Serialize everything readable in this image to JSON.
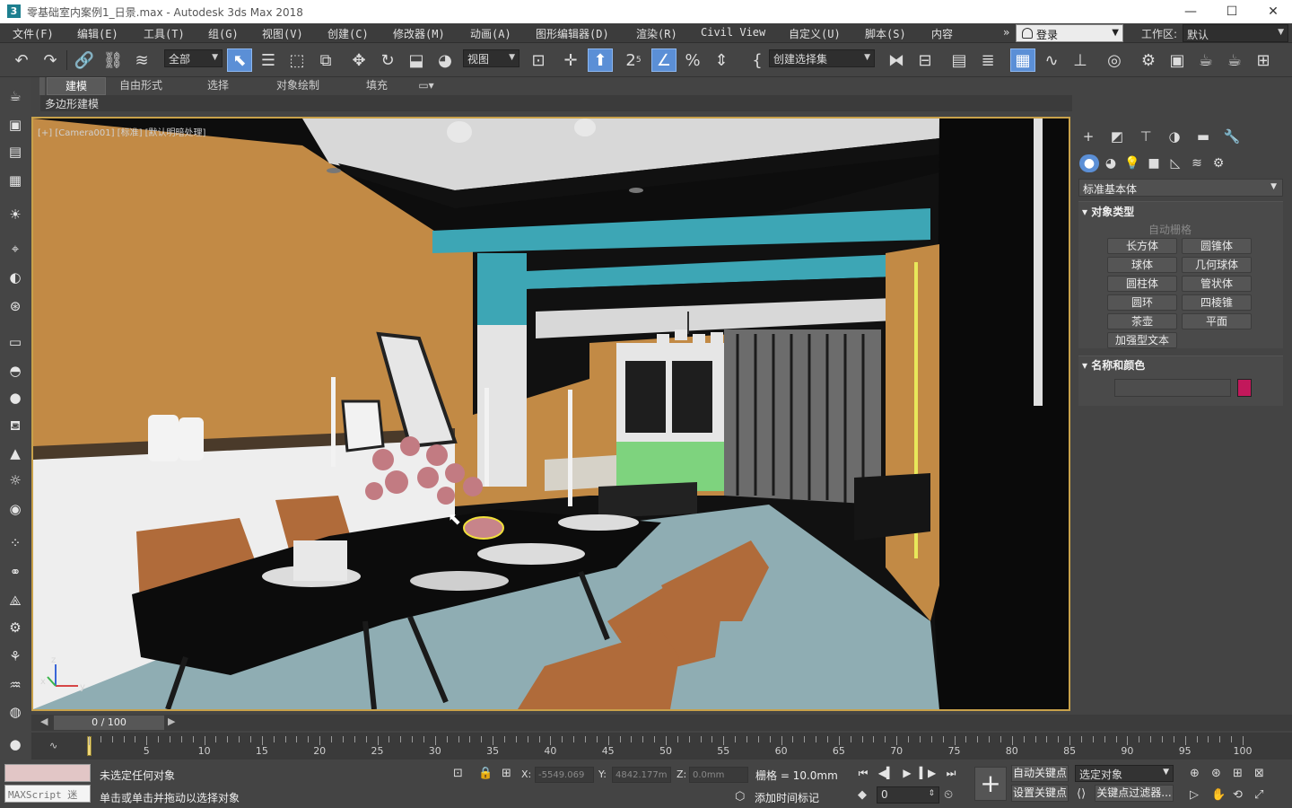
{
  "window": {
    "title": "零基础室内案例1_日景.max - Autodesk 3ds Max 2018",
    "app_icon": "3",
    "minimize": "—",
    "maximize": "☐",
    "close": "✕"
  },
  "menu": {
    "items": [
      "文件(F)",
      "编辑(E)",
      "工具(T)",
      "组(G)",
      "视图(V)",
      "创建(C)",
      "修改器(M)",
      "动画(A)",
      "图形编辑器(D)",
      "渲染(R)",
      "Civil View",
      "自定义(U)",
      "脚本(S)",
      "内容"
    ],
    "overflow": "»",
    "login": "登录",
    "workspace_label": "工作区:",
    "workspace_value": "默认"
  },
  "toolbar": {
    "selection_filter": "全部",
    "reference_coord": "视图",
    "named_selection": "创建选择集",
    "snap_angle_label": "2",
    "snap_sub": "5"
  },
  "ribbon": {
    "tabs": [
      "建模",
      "自由形式",
      "选择",
      "对象绘制",
      "填充"
    ],
    "active_tab": "建模",
    "sub_label": "多边形建模"
  },
  "viewport": {
    "label": "[+] [Camera001] [标准] [默认明暗处理]",
    "axis_x": "x",
    "axis_y": "y",
    "axis_z": "z"
  },
  "command_panel": {
    "category": "标准基本体",
    "rollout_object_type": "对象类型",
    "autogrid": "自动栅格",
    "object_buttons": [
      "长方体",
      "圆锥体",
      "球体",
      "几何球体",
      "圆柱体",
      "管状体",
      "圆环",
      "四棱锥",
      "茶壶",
      "平面",
      "加强型文本"
    ],
    "rollout_name_color": "名称和颜色",
    "color_swatch": "#c2185b"
  },
  "timeline": {
    "frame_display": "0 / 100",
    "ticks": [
      5,
      10,
      15,
      20,
      25,
      30,
      35,
      40,
      45,
      50,
      55,
      60,
      65,
      70,
      75,
      80,
      85,
      90,
      95,
      100
    ]
  },
  "status": {
    "maxscript_label": "MAXScript 迷",
    "line1": "未选定任何对象",
    "line2": "单击或单击并拖动以选择对象",
    "x_label": "X:",
    "x_value": "-5549.069",
    "y_label": "Y:",
    "y_value": "4842.177m",
    "z_label": "Z:",
    "z_value": "0.0mm",
    "grid": "栅格 = 10.0mm",
    "add_time_tag": "添加时间标记",
    "auto_key": "自动关键点",
    "set_key": "设置关键点",
    "key_mode_value": "选定对象",
    "key_filter": "关键点过滤器...",
    "frame_field": "0"
  }
}
